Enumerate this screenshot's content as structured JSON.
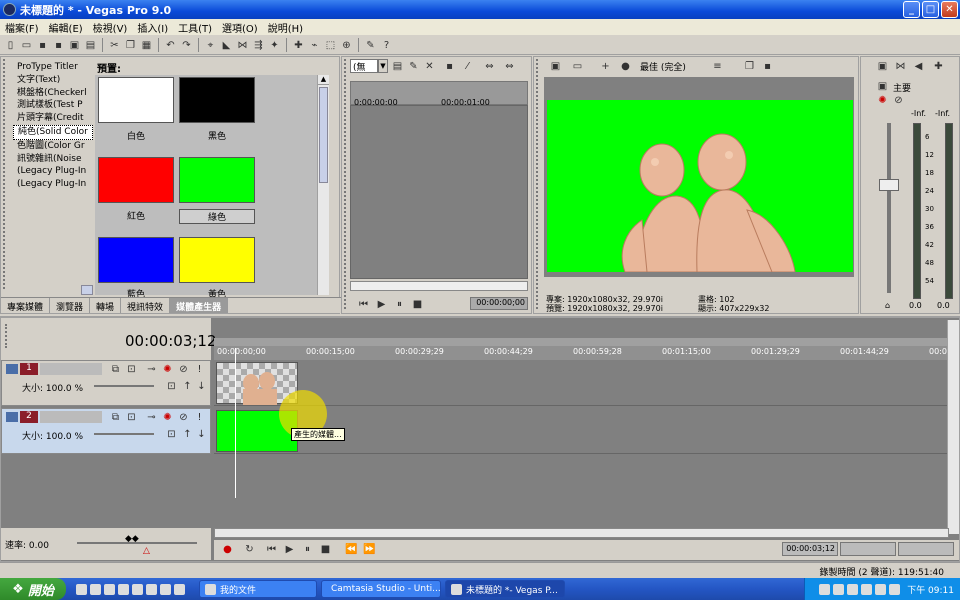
{
  "window": {
    "title": "未標題的 * - Vegas Pro 9.0"
  },
  "menu": [
    "檔案(F)",
    "編輯(E)",
    "檢視(V)",
    "插入(I)",
    "工具(T)",
    "選項(O)",
    "說明(H)"
  ],
  "media_generators": {
    "items": [
      "ProType Titler",
      "文字(Text)",
      "棋盤格(Checkerl",
      "測試樣板(Test P",
      "片頭字幕(Credit",
      "純色(Solid Color",
      "色階圖(Color Gr",
      "訊號雜訊(Noise",
      "(Legacy Plug-In",
      "(Legacy Plug-In"
    ],
    "selected_index": 5,
    "preset_label": "預置:",
    "swatches": [
      {
        "label": "白色",
        "color": "#ffffff"
      },
      {
        "label": "黑色",
        "color": "#000000"
      },
      {
        "label": "紅色",
        "color": "#ff0000"
      },
      {
        "label": "綠色",
        "color": "#00ff00"
      },
      {
        "label": "藍色",
        "color": "#0000ff"
      },
      {
        "label": "黃色",
        "color": "#ffff00"
      }
    ],
    "tabs": [
      "專案媒體",
      "瀏覽器",
      "轉場",
      "視訊特效",
      "媒體產生器"
    ],
    "active_tab": "媒體產生器"
  },
  "trimmer": {
    "dropdown": "(無",
    "start_tc": "0:00:00;00",
    "ruler_tc": "00:00:01;00",
    "timecode": "00:00:00;00"
  },
  "preview": {
    "quality": "最佳 (完全)",
    "project_label": "專案:",
    "project_value": "1920x1080x32, 29.970i",
    "preview_label": "預覽:",
    "preview_value": "1920x1080x32, 29.970i",
    "frame_label": "畫格:",
    "frame_value": "102",
    "display_label": "顯示:",
    "display_value": "407x229x32"
  },
  "master": {
    "label": "主要",
    "left_value": "-Inf.",
    "right_value": "-Inf.",
    "scale": [
      "6",
      "12",
      "18",
      "24",
      "30",
      "36",
      "42",
      "48",
      "54"
    ],
    "bottom_left": "0.0",
    "bottom_right": "0.0"
  },
  "timeline": {
    "cursor_tc": "00:00:03;12",
    "ruler": [
      "00:00:00;00",
      "00:00:15;00",
      "00:00:29;29",
      "00:00:44;29",
      "00:00:59;28",
      "00:01:15;00",
      "00:01:29;29",
      "00:01:44;29",
      "00:0"
    ],
    "tracks": [
      {
        "number": "1",
        "size_label": "大小: 100.0 %"
      },
      {
        "number": "2",
        "size_label": "大小: 100.0 %"
      }
    ],
    "tooltip": "產生的媒體...",
    "rate_label": "速率: 0.00",
    "bottom_tc": "00:00:03;12",
    "status": "錄製時間 (2 聲道): 119:51:40"
  },
  "taskbar": {
    "start": "開始",
    "items": [
      "我的文件",
      "Camtasia Studio - Unti...",
      "未標題的 *- Vegas P..."
    ],
    "active_index": 2,
    "clock": "下午 09:11"
  }
}
